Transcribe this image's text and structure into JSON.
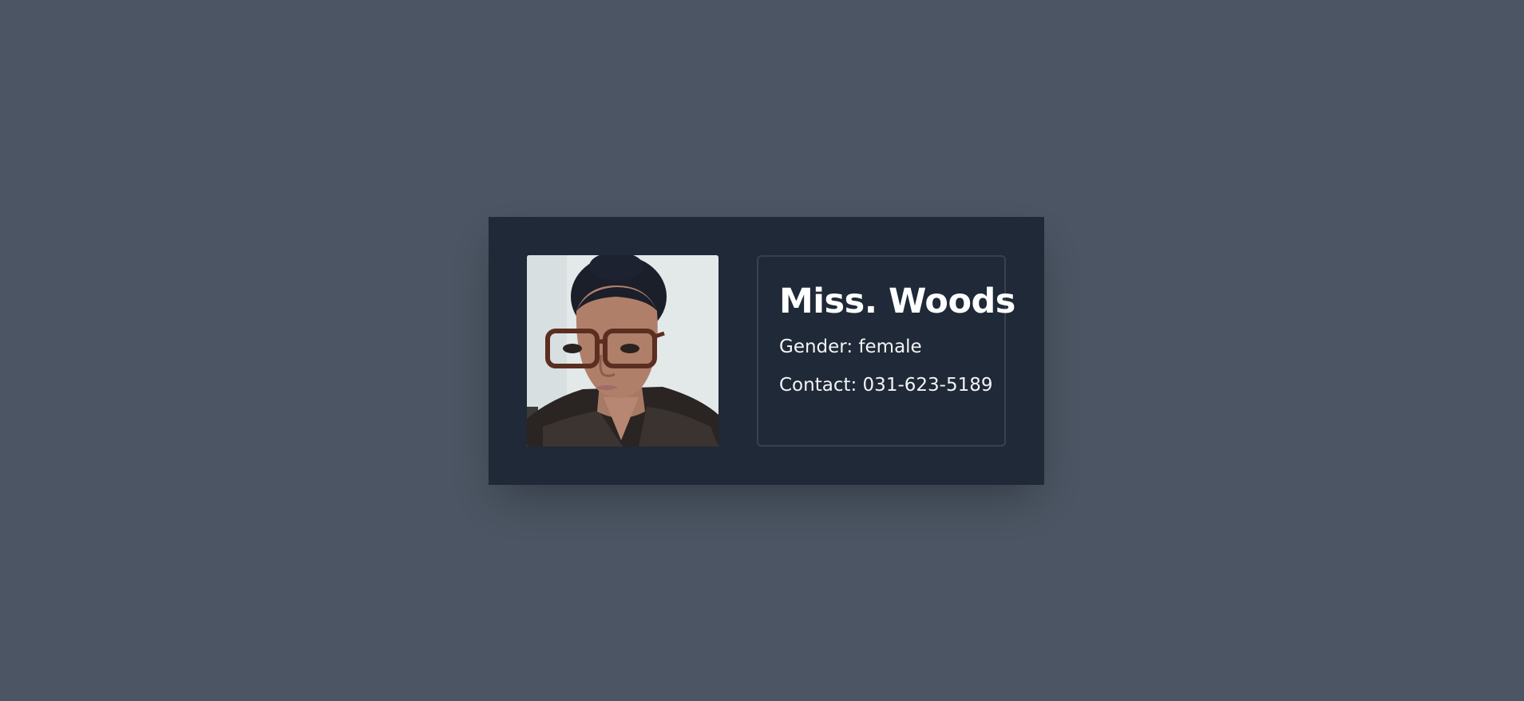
{
  "profile": {
    "name": "Miss. Woods",
    "gender_label": "Gender:",
    "gender": "female",
    "contact_label": "Contact:",
    "contact": "031-623-5189",
    "photo_alt": "Miss. Woods"
  },
  "colors": {
    "page_background": "#4b5563",
    "card_background": "#1f2937",
    "info_border": "#374151",
    "name_text": "#ffffff",
    "field_text": "#f3f4f6"
  }
}
